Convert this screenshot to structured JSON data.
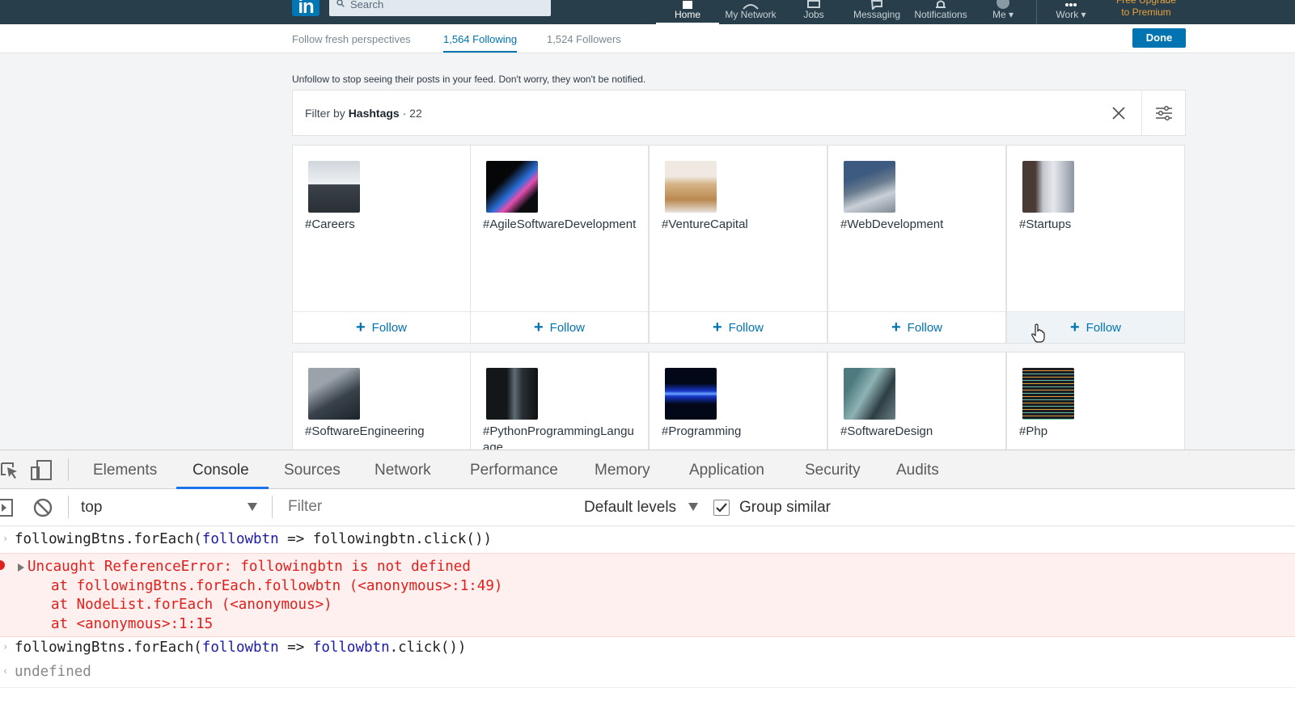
{
  "topnav": {
    "logo": "in",
    "search_placeholder": "Search",
    "items": [
      {
        "label": "Home",
        "icon": "home-icon",
        "active": true
      },
      {
        "label": "My Network",
        "icon": "network-icon"
      },
      {
        "label": "Jobs",
        "icon": "jobs-icon"
      },
      {
        "label": "Messaging",
        "icon": "messaging-icon"
      },
      {
        "label": "Notifications",
        "icon": "notifications-icon"
      },
      {
        "label": "Me",
        "icon": "avatar-icon"
      },
      {
        "label": "Work",
        "icon": "grid-icon"
      }
    ],
    "premium_line1": "Free Upgrade",
    "premium_line2": "to Premium"
  },
  "subheader": {
    "tabs": [
      {
        "label": "Follow fresh perspectives"
      },
      {
        "label": "1,564 Following",
        "active": true
      },
      {
        "label": "1,524 Followers"
      }
    ],
    "done_label": "Done"
  },
  "main": {
    "notice": "Unfollow to stop seeing their posts in your feed. Don't worry, they won't be notified.",
    "filter": {
      "prefix": "Filter by",
      "type": "Hashtags",
      "count": "· 22"
    },
    "follow_label": "Follow",
    "row1": [
      {
        "tag": "#Careers",
        "thumb": "office-photo"
      },
      {
        "tag": "#AgileSoftwareDevelopment",
        "thumb": "laptop-glow-photo"
      },
      {
        "tag": "#VentureCapital",
        "thumb": "wooden-house-photo"
      },
      {
        "tag": "#WebDevelopment",
        "thumb": "keyboard-photo"
      },
      {
        "tag": "#Startups",
        "thumb": "team-desk-photo"
      }
    ],
    "row2": [
      {
        "tag": "#SoftwareEngineering",
        "thumb": "laptop-code-photo"
      },
      {
        "tag": "#PythonProgrammingLanguage",
        "thumb": "phone-code-photo"
      },
      {
        "tag": "#Programming",
        "thumb": "blue-wave-photo"
      },
      {
        "tag": "#SoftwareDesign",
        "thumb": "developer-photo"
      },
      {
        "tag": "#Php",
        "thumb": "code-screen-photo"
      }
    ]
  },
  "devtools": {
    "tabs": [
      "Elements",
      "Console",
      "Sources",
      "Network",
      "Performance",
      "Memory",
      "Application",
      "Security",
      "Audits"
    ],
    "active_tab": "Console",
    "context": "top",
    "filter_placeholder": "Filter",
    "levels": "Default levels",
    "group_similar": "Group similar",
    "group_similar_checked": true,
    "console": {
      "cmd1_a": "followingBtns.forEach(",
      "cmd1_b": "followbtn",
      "cmd1_c": " => followingbtn.click())",
      "error_msg": "Uncaught ReferenceError: followingbtn is not defined",
      "stack1": "at followingBtns.forEach.followbtn (<anonymous>:1:49)",
      "stack2": "at NodeList.forEach (<anonymous>)",
      "stack3": "at <anonymous>:1:15",
      "cmd2_a": "followingBtns.forEach(",
      "cmd2_b": "followbtn",
      "cmd2_c": " => ",
      "cmd2_d": "followbtn",
      "cmd2_e": ".click())",
      "result": "undefined"
    }
  }
}
